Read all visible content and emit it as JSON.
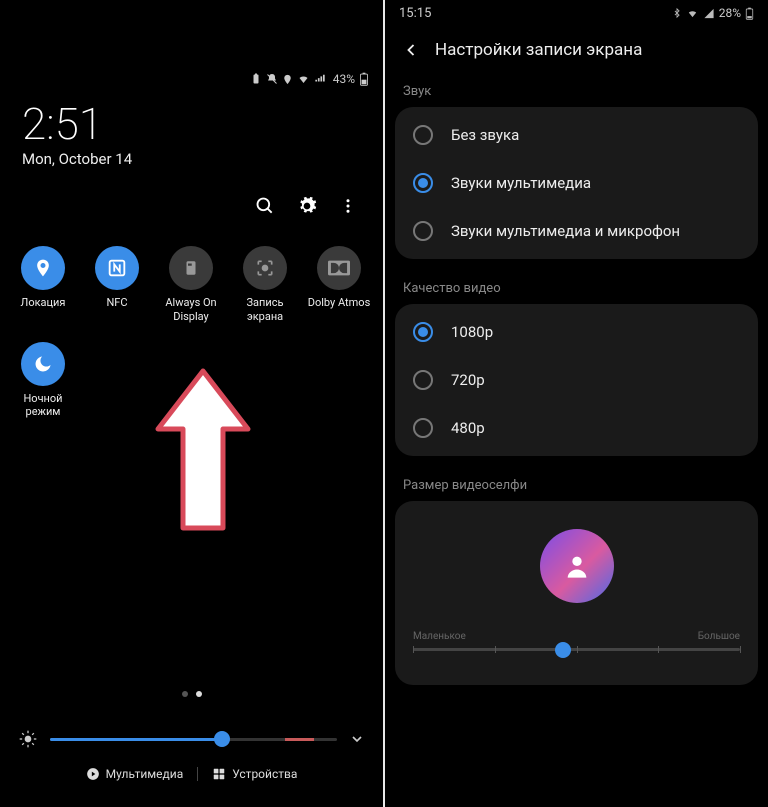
{
  "left": {
    "status": {
      "battery_pct": "43%",
      "icons": [
        "power-save",
        "mute",
        "location",
        "wifi",
        "signal"
      ]
    },
    "time": "2:51",
    "date": "Mon, October 14",
    "tiles": [
      {
        "label": "Локация",
        "icon": "location",
        "active": true
      },
      {
        "label": "NFC",
        "icon": "nfc",
        "active": true
      },
      {
        "label": "Always On Display",
        "icon": "aod",
        "active": false
      },
      {
        "label": "Запись экрана",
        "icon": "screen-record",
        "active": false
      },
      {
        "label": "Dolby Atmos",
        "icon": "dolby",
        "active": false
      },
      {
        "label": "Ночной режим",
        "icon": "moon",
        "active": true
      }
    ],
    "brightness_pct": 60,
    "bottom_tabs": {
      "left": "Мультимедиа",
      "right": "Устройства"
    }
  },
  "right": {
    "status": {
      "time": "15:15",
      "battery_pct": "28%"
    },
    "header": "Настройки записи экрана",
    "section_sound": "Звук",
    "sound_options": [
      {
        "label": "Без звука",
        "selected": false
      },
      {
        "label": "Звуки мультимедиа",
        "selected": true
      },
      {
        "label": "Звуки мультимедиа и микрофон",
        "selected": false
      }
    ],
    "section_quality": "Качество видео",
    "quality_options": [
      {
        "label": "1080p",
        "selected": true
      },
      {
        "label": "720p",
        "selected": false
      },
      {
        "label": "480p",
        "selected": false
      }
    ],
    "section_selfie": "Размер видеоселфи",
    "selfie_slider": {
      "min_label": "Маленькое",
      "max_label": "Большое",
      "value_pct": 46
    }
  }
}
